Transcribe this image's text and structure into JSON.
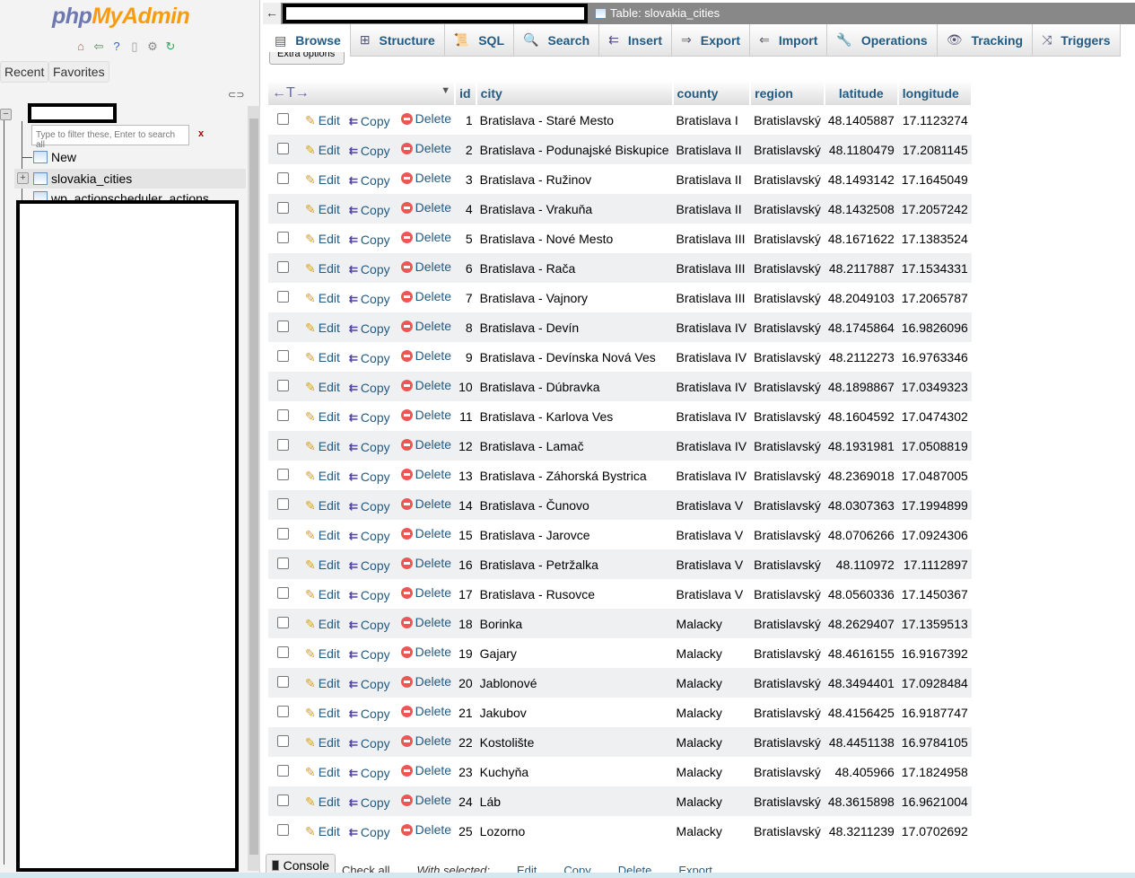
{
  "nav": {
    "logo": {
      "part1": "php",
      "part2": "MyAdmin"
    },
    "icons": [
      "home-icon",
      "logout-icon",
      "help-icon",
      "docs-icon",
      "settings-icon",
      "reload-icon"
    ],
    "tabs": [
      "Recent",
      "Favorites"
    ],
    "filter_placeholder": "Type to filter these, Enter to search all",
    "filter_clear": "x",
    "new_label": "New",
    "tables": [
      "slovakia_cities",
      "wp_actionscheduler_actions"
    ]
  },
  "topbar": {
    "breadcrumb": "Table: slovakia_cities",
    "back": "←"
  },
  "tabs": [
    {
      "label": "Browse",
      "icon": "▤"
    },
    {
      "label": "Structure",
      "icon": "⊞"
    },
    {
      "label": "SQL",
      "icon": "📜"
    },
    {
      "label": "Search",
      "icon": "🔍"
    },
    {
      "label": "Insert",
      "icon": "⇇"
    },
    {
      "label": "Export",
      "icon": "⇒"
    },
    {
      "label": "Import",
      "icon": "⇐"
    },
    {
      "label": "Operations",
      "icon": "🔧"
    },
    {
      "label": "Tracking",
      "icon": "👁"
    },
    {
      "label": "Triggers",
      "icon": "⤨"
    }
  ],
  "extra_options": "Extra options",
  "table": {
    "columns": [
      "id",
      "city",
      "county",
      "region",
      "latitude",
      "longitude"
    ],
    "actions": {
      "edit": "Edit",
      "copy": "Copy",
      "delete": "Delete"
    },
    "rows": [
      [
        1,
        "Bratislava - Staré Mesto",
        "Bratislava I",
        "Bratislavský",
        "48.1405887",
        "17.1123274"
      ],
      [
        2,
        "Bratislava - Podunajské Biskupice",
        "Bratislava II",
        "Bratislavský",
        "48.1180479",
        "17.2081145"
      ],
      [
        3,
        "Bratislava - Ružinov",
        "Bratislava II",
        "Bratislavský",
        "48.1493142",
        "17.1645049"
      ],
      [
        4,
        "Bratislava - Vrakuňa",
        "Bratislava II",
        "Bratislavský",
        "48.1432508",
        "17.2057242"
      ],
      [
        5,
        "Bratislava - Nové Mesto",
        "Bratislava III",
        "Bratislavský",
        "48.1671622",
        "17.1383524"
      ],
      [
        6,
        "Bratislava - Rača",
        "Bratislava III",
        "Bratislavský",
        "48.2117887",
        "17.1534331"
      ],
      [
        7,
        "Bratislava - Vajnory",
        "Bratislava III",
        "Bratislavský",
        "48.2049103",
        "17.2065787"
      ],
      [
        8,
        "Bratislava - Devín",
        "Bratislava IV",
        "Bratislavský",
        "48.1745864",
        "16.9826096"
      ],
      [
        9,
        "Bratislava - Devínska Nová Ves",
        "Bratislava IV",
        "Bratislavský",
        "48.2112273",
        "16.9763346"
      ],
      [
        10,
        "Bratislava - Dúbravka",
        "Bratislava IV",
        "Bratislavský",
        "48.1898867",
        "17.0349323"
      ],
      [
        11,
        "Bratislava - Karlova Ves",
        "Bratislava IV",
        "Bratislavský",
        "48.1604592",
        "17.0474302"
      ],
      [
        12,
        "Bratislava - Lamač",
        "Bratislava IV",
        "Bratislavský",
        "48.1931981",
        "17.0508819"
      ],
      [
        13,
        "Bratislava - Záhorská Bystrica",
        "Bratislava IV",
        "Bratislavský",
        "48.2369018",
        "17.0487005"
      ],
      [
        14,
        "Bratislava - Čunovo",
        "Bratislava V",
        "Bratislavský",
        "48.0307363",
        "17.1994899"
      ],
      [
        15,
        "Bratislava - Jarovce",
        "Bratislava V",
        "Bratislavský",
        "48.0706266",
        "17.0924306"
      ],
      [
        16,
        "Bratislava - Petržalka",
        "Bratislava V",
        "Bratislavský",
        "48.110972",
        "17.1112897"
      ],
      [
        17,
        "Bratislava - Rusovce",
        "Bratislava V",
        "Bratislavský",
        "48.0560336",
        "17.1450367"
      ],
      [
        18,
        "Borinka",
        "Malacky",
        "Bratislavský",
        "48.2629407",
        "17.1359513"
      ],
      [
        19,
        "Gajary",
        "Malacky",
        "Bratislavský",
        "48.4616155",
        "16.9167392"
      ],
      [
        20,
        "Jablonové",
        "Malacky",
        "Bratislavský",
        "48.3494401",
        "17.0928484"
      ],
      [
        21,
        "Jakubov",
        "Malacky",
        "Bratislavský",
        "48.4156425",
        "16.9187747"
      ],
      [
        22,
        "Kostolište",
        "Malacky",
        "Bratislavský",
        "48.4451138",
        "16.9784105"
      ],
      [
        23,
        "Kuchyňa",
        "Malacky",
        "Bratislavský",
        "48.405966",
        "17.1824958"
      ],
      [
        24,
        "Láb",
        "Malacky",
        "Bratislavský",
        "48.3615898",
        "16.9621004"
      ],
      [
        25,
        "Lozorno",
        "Malacky",
        "Bratislavský",
        "48.3211239",
        "17.0702692"
      ]
    ]
  },
  "console": "Console",
  "bottom": {
    "check_all": "Check all",
    "with_selected": "With selected:",
    "edit": "Edit",
    "copy": "Copy",
    "delete": "Delete",
    "export": "Export"
  }
}
